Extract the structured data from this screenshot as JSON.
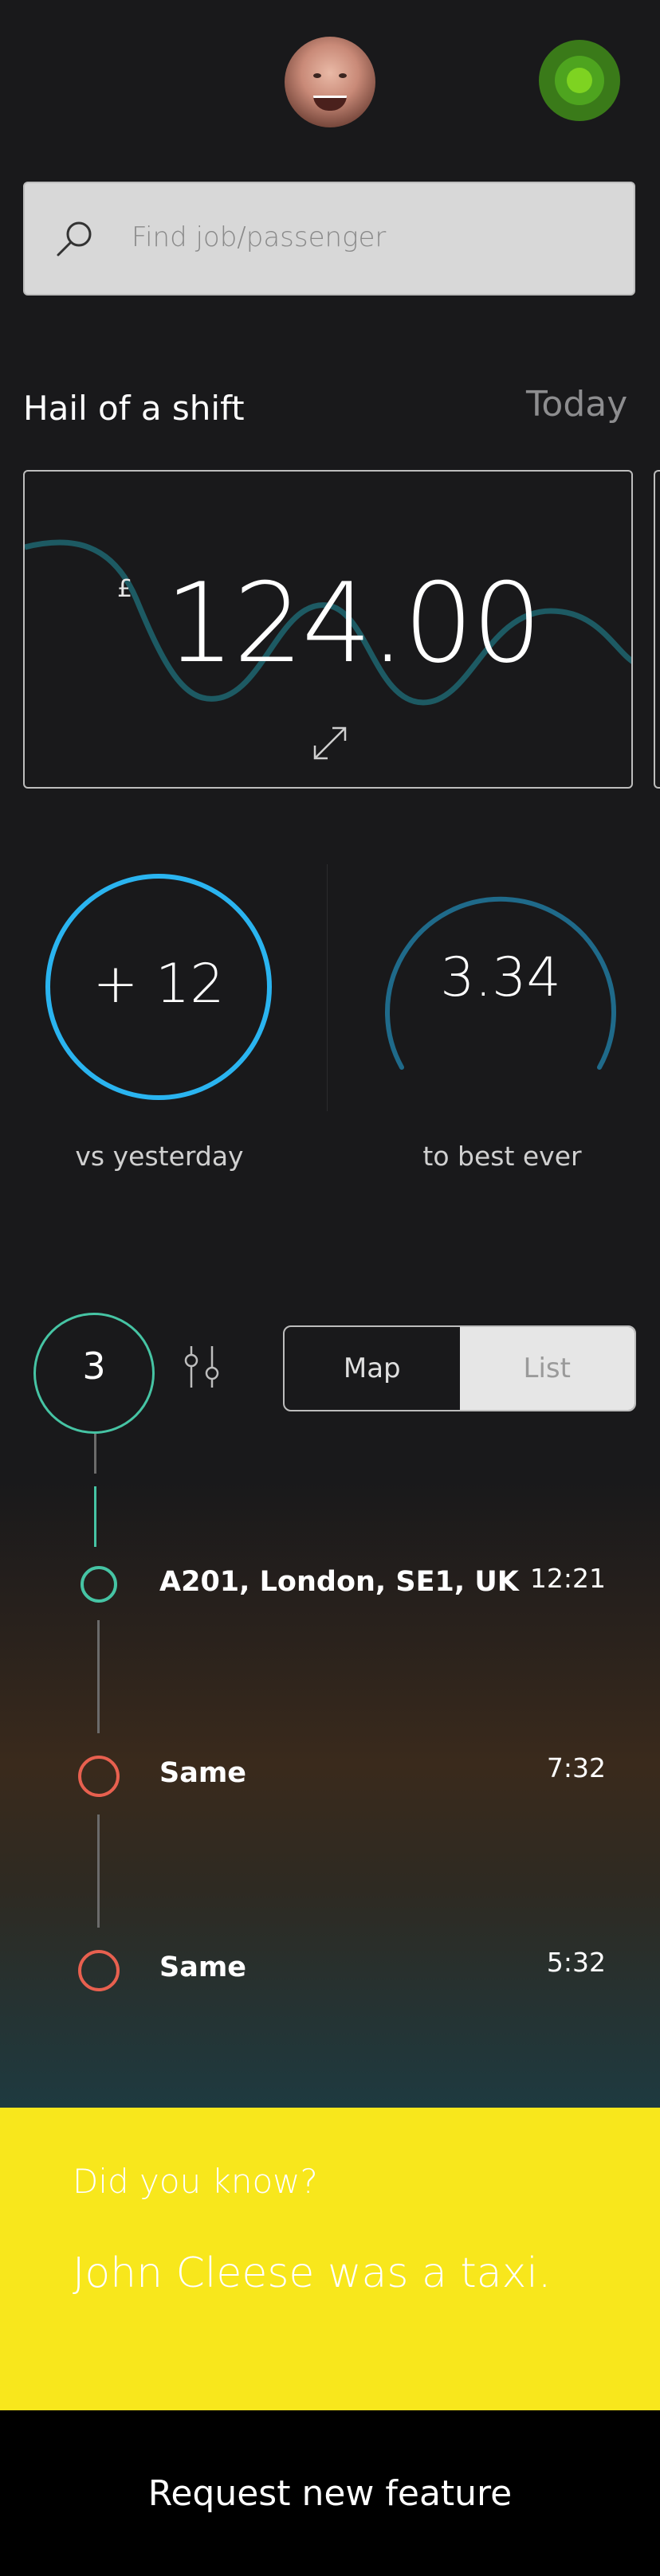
{
  "header": {
    "avatar_icon": "user-avatar",
    "status_icon": "online-status-dot",
    "status_color": "#7ed321"
  },
  "search": {
    "placeholder": "Find job/passenger",
    "icon": "search-icon"
  },
  "shift": {
    "title": "Hail of a shift",
    "period": "Today",
    "currency": "£",
    "amount": "124.00",
    "expand_icon": "expand-icon"
  },
  "stats": {
    "left": {
      "value": "+ 12",
      "label": "vs yesterday",
      "color": "#2ab4f0"
    },
    "right": {
      "value": "3.34",
      "label": "to best ever",
      "color": "#1f6a8a"
    }
  },
  "jobs": {
    "count": "3",
    "filter_icon": "filter-sliders-icon",
    "view_toggle": {
      "map": "Map",
      "list": "List",
      "selected": "List"
    },
    "items": [
      {
        "address": "A201, London, SE1, UK",
        "time": "12:21",
        "status_color": "#46c4a4"
      },
      {
        "address": "Same",
        "time": "7:32",
        "status_color": "#e8604f"
      },
      {
        "address": "Same",
        "time": "5:32",
        "status_color": "#e8604f"
      }
    ]
  },
  "did_you_know": {
    "title": "Did you know?",
    "body": "John Cleese was a taxi.",
    "background": "#f8e71c"
  },
  "footer": {
    "cta": "Request new feature"
  }
}
